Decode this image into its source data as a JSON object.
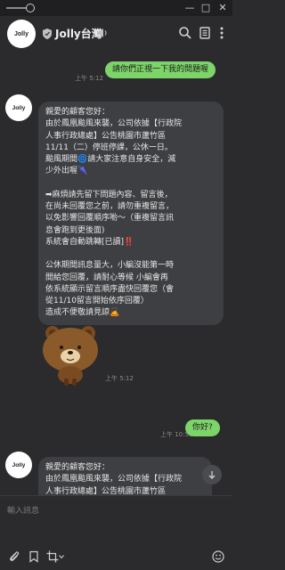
{
  "titlebar": {
    "minimize_label": "—",
    "maximize_label": "□",
    "close_label": "✕"
  },
  "header": {
    "avatar_text": "Jolly",
    "chat_name": "Jolly台灣",
    "icons": [
      "shield-icon",
      "mute-icon",
      "search-icon",
      "notes-icon",
      "more-icon"
    ]
  },
  "messages": {
    "out1": {
      "time": "上午 5:12",
      "text": "請你們正視一下我的問題喔"
    },
    "in1": {
      "avatar_text": "Jolly",
      "lines": [
        "親愛的顧客您好：",
        "由於鳳凰颱風來襲，公司依據【行政院",
        "人事行政總處】公告桃園市蘆竹區",
        "11/11（二）停班停課，公休一日。",
        "颱風期間🌀請大家注意自身安全，減",
        "少外出喔🌂",
        "",
        "➡麻煩請先留下問題內容、留言後，",
        "在尚未回覆您之前，請勿重複留言，",
        "以免影響回覆順序喲～（重複留言訊",
        "息會跑到更後面)",
        "系統會自動跳轉[已讀]‼️",
        "",
        "公休期間訊息量大，小編沒能第一時",
        "間給您回覆，請耐心等候 小編會再",
        "依系統顯示留言順序盡快回覆您（會",
        "從11/10留言開始依序回覆）",
        "造成不便敬請見諒🙇"
      ]
    },
    "sticker": {
      "time": "上午 5:12",
      "name": "brown-bear-sticker"
    },
    "out2": {
      "time": "上午 10:53",
      "text": "你好?"
    },
    "in2": {
      "avatar_text": "Jolly",
      "lines": [
        "親愛的顧客您好：",
        "由於鳳凰颱風來襲，公司依據【行政院",
        "人事行政總處】公告桃園市蘆竹區"
      ]
    }
  },
  "input": {
    "placeholder": "輸入訊息"
  },
  "colors": {
    "bg": "#2b2b2d",
    "bubble_out": "#7dd569",
    "bubble_in": "#3e3f42",
    "sticker_brown": "#8b5a2b"
  },
  "toolbar_icons": [
    "attach-icon",
    "bookmark-icon",
    "crop-icon",
    "emoji-icon"
  ]
}
